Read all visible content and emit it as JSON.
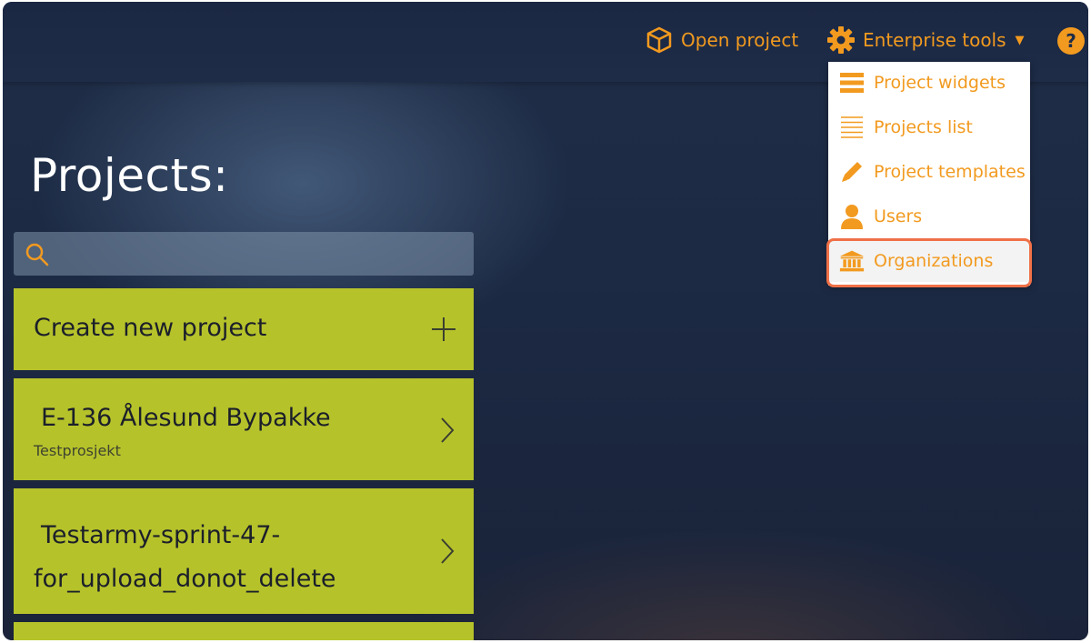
{
  "topbar": {
    "open_project": "Open project",
    "enterprise_tools": "Enterprise tools",
    "help": "?"
  },
  "dropdown": {
    "items": [
      {
        "label": "Project widgets",
        "icon": "menu-lines-icon"
      },
      {
        "label": "Projects list",
        "icon": "list-icon"
      },
      {
        "label": "Project templates",
        "icon": "pencil-icon"
      },
      {
        "label": "Users",
        "icon": "user-icon"
      },
      {
        "label": "Organizations",
        "icon": "bank-icon",
        "highlighted": true
      }
    ]
  },
  "main": {
    "title": "Projects:",
    "search_placeholder": "",
    "create_label": "Create new project",
    "projects": [
      {
        "name": "E-136 Ålesund Bypakke",
        "subtitle": "Testprosjekt"
      },
      {
        "name": "Testarmy-sprint-47-for_upload_donot_delete",
        "subtitle": ""
      }
    ]
  },
  "colors": {
    "accent": "#f29a1f",
    "card": "#b6c22a",
    "highlight_ring": "#f07047",
    "background": "#1e2c48"
  }
}
